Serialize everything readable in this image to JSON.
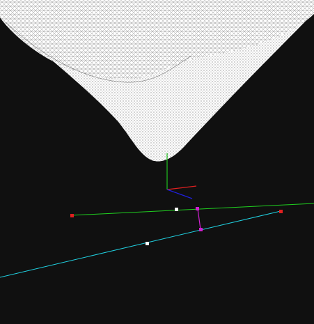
{
  "viewport": {
    "background_color": "#101010"
  },
  "mesh": {
    "shape": "wireframe-rounded-v",
    "fill_color": "#ffffff",
    "line_color": "#000000",
    "shadow_color": "#222222"
  },
  "axes_gizmo": {
    "x_color": "#e02020",
    "y_color": "#20c020",
    "z_color": "#2020e0"
  },
  "construction": {
    "line_a_color": "#20d020",
    "line_b_color": "#20d0e0",
    "connector_color": "#d020d0",
    "endpoint_color": "#e02020",
    "midpoint_color": "#ffffff",
    "foot_point_color": "#d020d0"
  }
}
